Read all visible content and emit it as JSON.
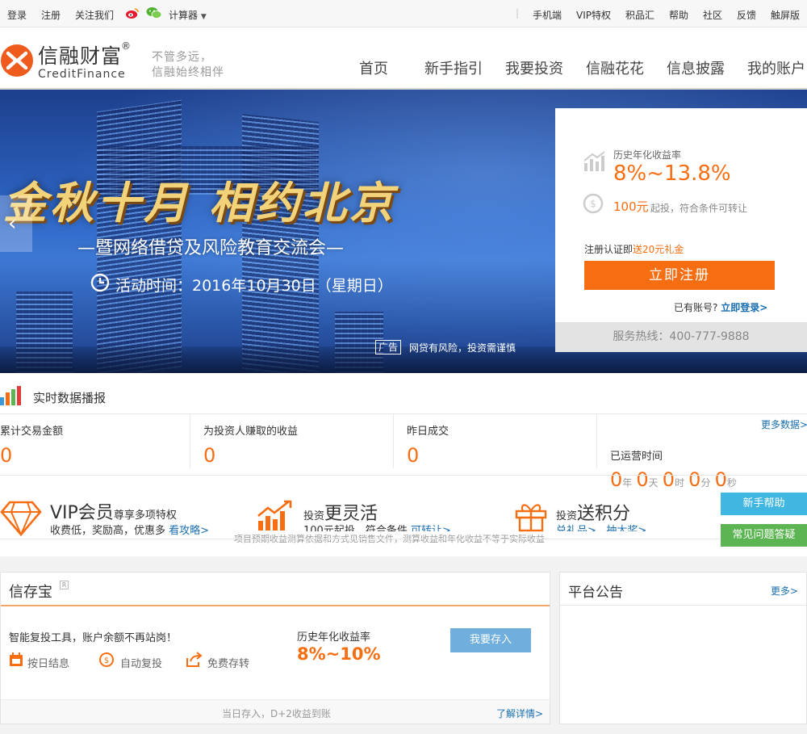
{
  "topbar": {
    "left": [
      "登录",
      "注册",
      "关注我们"
    ],
    "calculator": "计算器",
    "right": [
      "手机端",
      "VIP特权",
      "积品汇",
      "帮助",
      "社区",
      "反馈",
      "触屏版"
    ]
  },
  "brand": {
    "name_cn": "信融财富",
    "name_en": "CreditFinance",
    "reg": "®",
    "slogan1": "不管多远，",
    "slogan2": "信融始终相伴"
  },
  "nav": [
    "首页",
    "新手指引",
    "我要投资",
    "信融花花",
    "信息披露",
    "我的账户"
  ],
  "banner": {
    "headline": "金秋十月 相约北京",
    "subtitle": "—暨网络借贷及风险教育交流会—",
    "time": "活动时间：2016年10月30日（星期日）",
    "ad_tag": "广告",
    "risk": "网贷有风险，投资需谨慎"
  },
  "panel": {
    "rate_label": "历史年化收益率",
    "rate_value": "8%~13.8%",
    "min_invest": "100元",
    "min_note": "起投，符合条件可转让",
    "reg_text": "注册认证即",
    "reg_gift": "送20元礼金",
    "register_btn": "立即注册",
    "have_account": "已有账号?",
    "login_link": "立即登录>",
    "hotline": "服务热线：400-777-9888"
  },
  "stats": {
    "title": "实时数据播报",
    "cols": [
      {
        "label": "累计交易金额",
        "value": "0"
      },
      {
        "label": "为投资人赚取的收益",
        "value": "0"
      },
      {
        "label": "昨日成交",
        "value": "0"
      }
    ],
    "more": "更多数据>",
    "op_label": "已运营时间",
    "op": {
      "y": "0",
      "y_u": "年",
      "d": "0",
      "d_u": "天",
      "h": "0",
      "h_u": "时",
      "m": "0",
      "m_u": "分",
      "s": "0",
      "s_u": "秒"
    }
  },
  "features": [
    {
      "title": "VIP会员",
      "title_small": "尊享多项特权",
      "desc": "收费低，奖励高，优惠多",
      "link": "看攻略>"
    },
    {
      "pre": "投资",
      "title": "更灵活",
      "desc": "100元起投，符合条件",
      "link": "可转让>"
    },
    {
      "pre": "投资",
      "title": "送积分",
      "link1": "兑礼品>",
      "link2": "抽大奖>"
    }
  ],
  "disclaimer": "项目预期收益测算依据和方式见销售文件，测算收益和年化收益不等于实际收益",
  "side_buttons": {
    "help": "新手帮助",
    "faq": "常见问题答疑"
  },
  "xcb": {
    "title": "信存宝",
    "mark": "R",
    "desc": "智能复投工具，账户余额不再站岗！",
    "tags": [
      "按日结息",
      "自动复投",
      "免费存转"
    ],
    "rate_label": "历史年化收益率",
    "rate": "8%~10%",
    "btn": "我要存入",
    "footer": "当日存入，D+2收益到账",
    "detail": "了解详情>"
  },
  "notice": {
    "title": "平台公告",
    "more": "更多>"
  },
  "colors": {
    "accent": "#f66d12",
    "link": "#1a6fb0",
    "help": "#3fb7e0",
    "faq": "#5cb552"
  }
}
